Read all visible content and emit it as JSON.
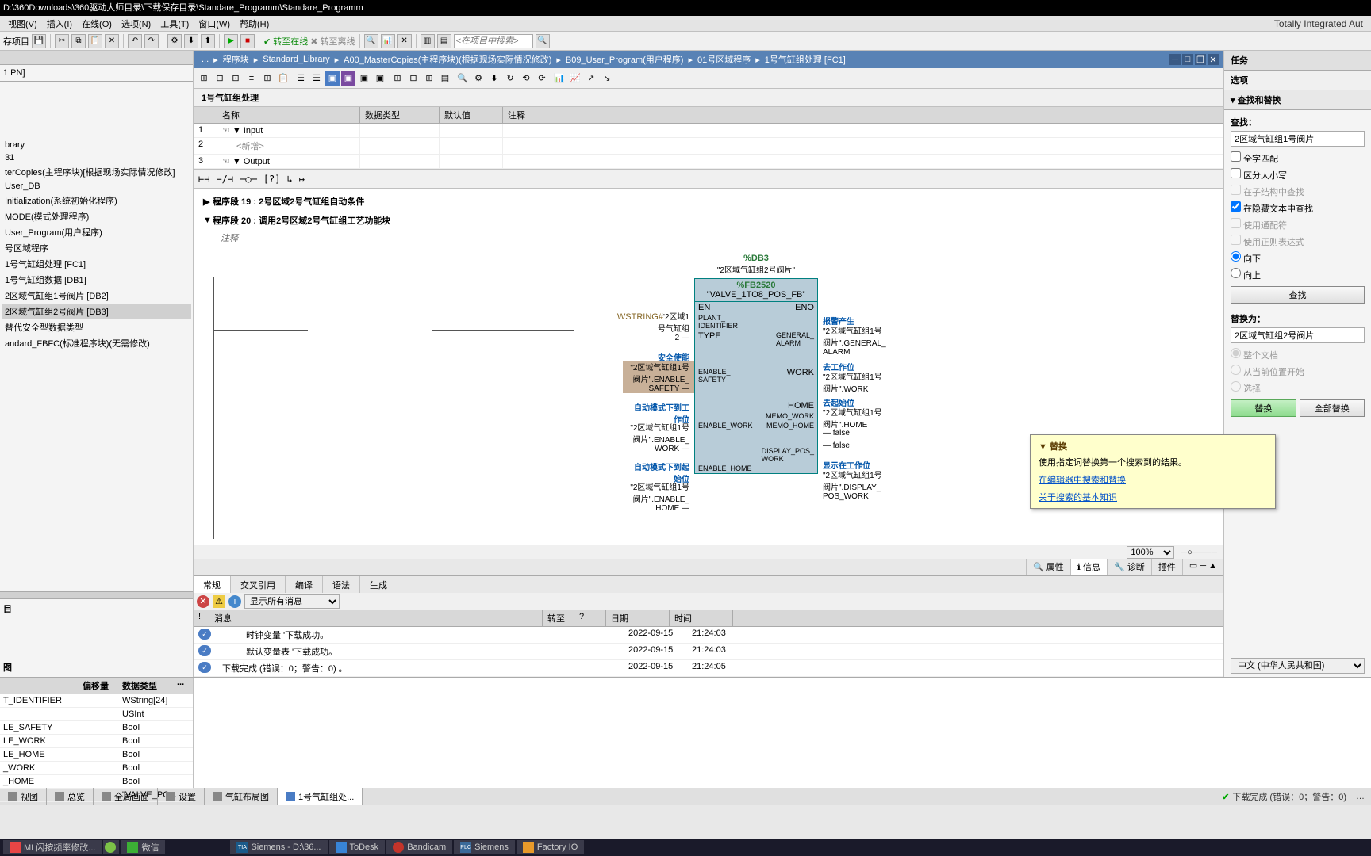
{
  "titlebar": "D:\\360Downloads\\360驱动大师目录\\下载保存目录\\Standare_Programm\\Standare_Programm",
  "menus": [
    "视图(V)",
    "插入(I)",
    "在线(O)",
    "选项(N)",
    "工具(T)",
    "窗口(W)",
    "帮助(H)"
  ],
  "brand": "Totally Integrated Aut",
  "toolbar_project": "存项目",
  "toolbar_online": "转至在线",
  "toolbar_offline": "转至离线",
  "toolbar_search_ph": "<在项目中搜索>",
  "left_pn": "1 PN]",
  "tree": [
    "brary",
    "31",
    "terCopies(主程序块)[根据现场实际情况修改]",
    "User_DB",
    "Initialization(系统初始化程序)",
    "MODE(模式处理程序)",
    "User_Program(用户程序)",
    "号区域程序",
    "1号气缸组处理 [FC1]",
    "1号气缸组数据 [DB1]",
    "2区域气缸组1号阀片 [DB2]",
    "2区域气缸组2号阀片 [DB3]",
    "替代安全型数据类型",
    "andard_FBFC(标准程序块)(无需修改)"
  ],
  "tree_selected_index": 11,
  "breadcrumbs": [
    "...",
    "程序块",
    "Standard_Library",
    "A00_MasterCopies(主程序块)(根据现场实际情况修改)",
    "B09_User_Program(用户程序)",
    "01号区域程序",
    "1号气缸组处理 [FC1]"
  ],
  "block_title": "1号气缸组处理",
  "interface": {
    "headers": [
      "",
      "名称",
      "数据类型",
      "默认值",
      "注释"
    ],
    "rows": [
      {
        "n": "1",
        "name": "Input",
        "kind": "▼"
      },
      {
        "n": "2",
        "name": "<新增>",
        "kind": ""
      },
      {
        "n": "3",
        "name": "Output",
        "kind": "▼"
      }
    ]
  },
  "networks": [
    {
      "num": "程序段 19 :",
      "title": "2号区域2号气缸组自动条件"
    },
    {
      "num": "程序段 20 :",
      "title": "调用2号区域2号气缸组工艺功能块"
    }
  ],
  "comment_label": "注释",
  "fb": {
    "db_num": "%DB3",
    "db_name": "\"2区域气缸组2号阀片\"",
    "fb_num": "%FB2520",
    "fb_name": "\"VALVE_1TO8_POS_FB\"",
    "left_pins": [
      {
        "val": "",
        "pin": "EN"
      },
      {
        "val": "WSTRING#'2区域1号气缸组",
        "pin": "PLANT_IDENTIFIER"
      },
      {
        "val": "2",
        "pin": "TYPE"
      },
      {
        "val": "安全使能\n\"2区域气缸组1号阀片\".ENABLE_SAFETY",
        "pin": "ENABLE_SAFETY"
      },
      {
        "val": "自动模式下到工作位\n\"2区域气缸组1号阀片\".ENABLE_WORK",
        "pin": "ENABLE_WORK"
      },
      {
        "val": "自动模式下到起始位\n\"2区域气缸组1号阀片\".ENABLE_HOME",
        "pin": "ENABLE_HOME"
      }
    ],
    "right_pins": [
      {
        "pin": "ENO",
        "val": ""
      },
      {
        "pin": "GENERAL_ALARM",
        "val": "报警产生\n\"2区域气缸组1号阀片\".GENERAL_ALARM"
      },
      {
        "pin": "WORK",
        "val": "去工作位\n\"2区域气缸组1号阀片\".WORK"
      },
      {
        "pin": "HOME",
        "val": "去起始位\n\"2区域气缸组1号阀片\".HOME"
      },
      {
        "pin": "MEMO_WORK",
        "val": "false"
      },
      {
        "pin": "MEMO_HOME",
        "val": "false"
      },
      {
        "pin": "DISPLAY_POS_WORK",
        "val": "显示在工作位\n\"2区域气缸组1号阀片\".DISPLAY_POS_WORK"
      }
    ]
  },
  "zoom": "100%",
  "prop_tabs": [
    "属性",
    "信息",
    "诊断",
    "插件"
  ],
  "prop_tab_active": 1,
  "info_tabs": [
    "常规",
    "交叉引用",
    "编译",
    "语法",
    "生成"
  ],
  "info_tab_active": 0,
  "msg_filter": "显示所有消息",
  "msg_headers": [
    "!",
    "消息",
    "转至",
    "?",
    "日期",
    "时间"
  ],
  "msgs": [
    {
      "text": "时钟变量 '下载成功。",
      "date": "2022-09-15",
      "time": "21:24:03"
    },
    {
      "text": "默认变量表 '下载成功。",
      "date": "2022-09-15",
      "time": "21:24:03"
    },
    {
      "text": "下载完成 (错误：0；警告：0) 。",
      "date": "2022-09-15",
      "time": "21:24:05"
    }
  ],
  "props_rows": [
    {
      "name": "T_IDENTIFIER",
      "type": "WString[24]"
    },
    {
      "name": "",
      "type": "USInt"
    },
    {
      "name": "LE_SAFETY",
      "type": "Bool"
    },
    {
      "name": "LE_WORK",
      "type": "Bool"
    },
    {
      "name": "LE_HOME",
      "type": "Bool"
    },
    {
      "name": "_WORK",
      "type": "Bool"
    },
    {
      "name": "_HOME",
      "type": "Bool"
    },
    {
      "name": "",
      "type": "\"VALVE_PO..."
    }
  ],
  "props_headers": {
    "offset": "偏移量",
    "type": "数据类型"
  },
  "right": {
    "title": "任务",
    "options": "选项",
    "section": "查找和替换",
    "find_label": "查找：",
    "find_value": "2区域气缸组1号阀片",
    "chk_whole": "全字匹配",
    "chk_case": "区分大小写",
    "chk_sub": "在子结构中查找",
    "chk_hidden": "在隐藏文本中查找",
    "chk_wild": "使用通配符",
    "chk_regex": "使用正则表达式",
    "radio_down": "向下",
    "radio_up": "向上",
    "btn_find": "查找",
    "replace_label": "替换为：",
    "replace_value": "2区域气缸组2号阀片",
    "scope_doc": "整个文档",
    "scope_cursor": "从当前位置开始",
    "scope_sel": "选择",
    "btn_replace": "替换",
    "btn_replace_all": "全部替换",
    "lang": "中文 (中华人民共和国)"
  },
  "tooltip": {
    "title": "替换",
    "body": "使用指定词替换第一个搜索到的结果。",
    "link1": "在编辑器中搜索和替换",
    "link2": "关于搜索的基本知识"
  },
  "view_tabs": [
    "视图",
    "总览",
    "全局画面",
    "设置",
    "气缸布局图",
    "1号气缸组处..."
  ],
  "view_tab_active": 5,
  "status_text": "下载完成 (错误：0；警告：0)",
  "taskbar": [
    {
      "label": "MI 闪按频率修改...",
      "color": "#e84545"
    },
    {
      "label": "",
      "color": "#7cc247"
    },
    {
      "label": "微信",
      "color": "#3cb035"
    },
    {
      "label": "Siemens - D:\\36...",
      "color": "#1a5a8a"
    },
    {
      "label": "ToDesk",
      "color": "#3884d6"
    },
    {
      "label": "Bandicam",
      "color": "#c4342a"
    },
    {
      "label": "Siemens",
      "color": "#3a6a9a"
    },
    {
      "label": "Factory IO",
      "color": "#e89a2a"
    }
  ]
}
